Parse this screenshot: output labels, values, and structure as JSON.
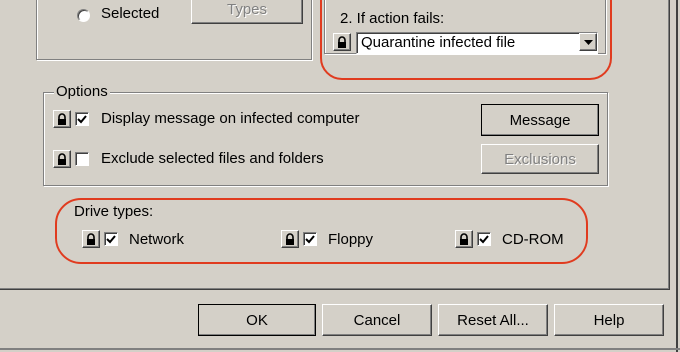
{
  "scan_type": {
    "selected_label": "Selected",
    "types_button": "Types"
  },
  "action": {
    "label": "2. If action fails:",
    "selected_value": "Quarantine infected file"
  },
  "options": {
    "title": "Options",
    "display_message": {
      "label": "Display message on infected computer",
      "checked": true
    },
    "exclude_files": {
      "label": "Exclude selected files and folders",
      "checked": false
    },
    "message_button": "Message",
    "exclusions_button": "Exclusions"
  },
  "drive_types": {
    "title": "Drive types:",
    "network": {
      "label": "Network",
      "checked": true
    },
    "floppy": {
      "label": "Floppy",
      "checked": true
    },
    "cdrom": {
      "label": "CD-ROM",
      "checked": true
    }
  },
  "footer": {
    "ok": "OK",
    "cancel": "Cancel",
    "reset_all": "Reset All...",
    "help": "Help"
  },
  "colors": {
    "face": "#d4d0c8",
    "highlight_ring": "#e03b1f"
  }
}
